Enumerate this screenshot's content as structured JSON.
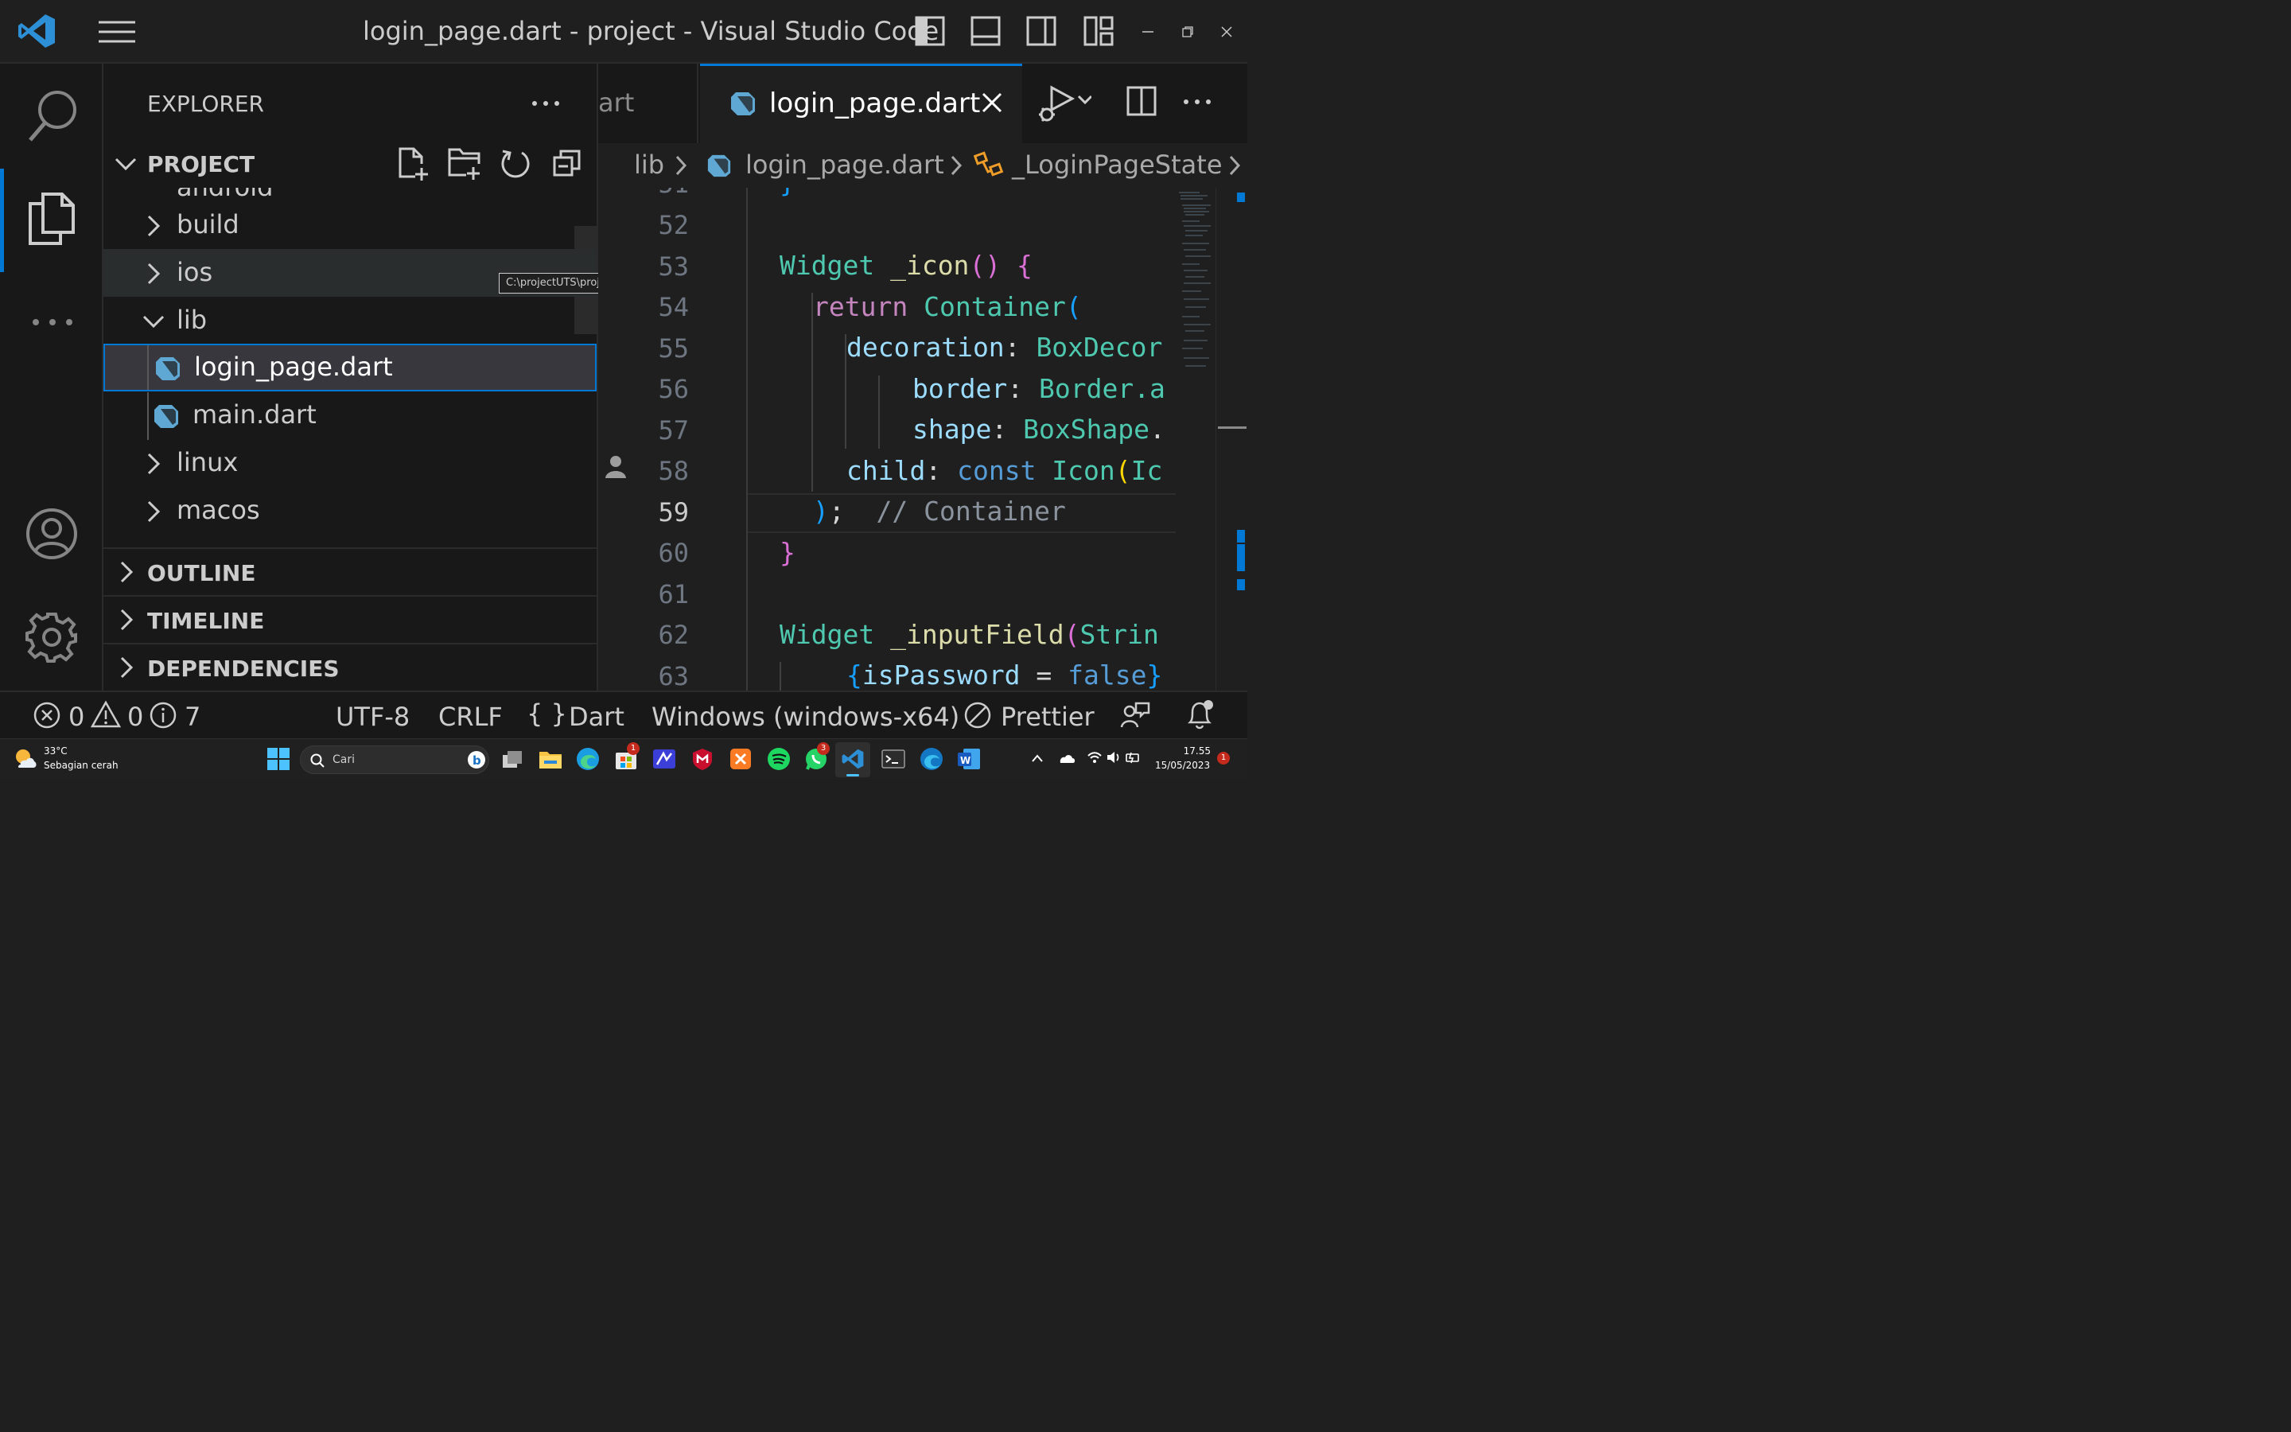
{
  "window": {
    "title": "login_page.dart - project - Visual Studio Code"
  },
  "sidebar": {
    "header": "EXPLORER",
    "project_label": "PROJECT",
    "tree": [
      {
        "label": "build",
        "type": "folder",
        "expanded": false
      },
      {
        "label": "ios",
        "type": "folder",
        "expanded": false
      },
      {
        "label": "lib",
        "type": "folder",
        "expanded": true
      },
      {
        "label": "login_page.dart",
        "type": "file",
        "selected": true
      },
      {
        "label": "main.dart",
        "type": "file"
      },
      {
        "label": "linux",
        "type": "folder",
        "expanded": false
      },
      {
        "label": "macos",
        "type": "folder",
        "expanded": false
      }
    ],
    "tooltip": "C:\\projectUTS\\project\\ios",
    "sections": [
      "OUTLINE",
      "TIMELINE",
      "DEPENDENCIES"
    ]
  },
  "tabs": {
    "inactive_partial": "art",
    "active": "login_page.dart"
  },
  "breadcrumbs": [
    "lib",
    "login_page.dart",
    "_LoginPageState"
  ],
  "editor": {
    "line_numbers": [
      "52",
      "53",
      "54",
      "55",
      "56",
      "57",
      "58",
      "59",
      "60",
      "61",
      "62",
      "63"
    ],
    "current_line": "59",
    "code": {
      "l53_a": "Widget",
      "l53_b": " _icon",
      "l53_c": "()",
      "l53_d": " {",
      "l54_a": "return",
      "l54_b": " Container",
      "l54_c": "(",
      "l55_a": "decoration",
      "l55_b": ": ",
      "l55_c": "BoxDecor",
      "l56_a": "border",
      "l56_b": ": ",
      "l56_c": "Border",
      "l56_d": ".a",
      "l57_a": "shape",
      "l57_b": ": ",
      "l57_c": "BoxShape",
      "l57_d": ".",
      "l58_a": "child",
      "l58_b": ": ",
      "l58_c": "const",
      "l58_d": " Icon",
      "l58_e": "(",
      "l58_f": "Ic",
      "l59_a": ")",
      "l59_b": ";",
      "l59_c": "  // Container",
      "l60_a": "}",
      "l62_a": "Widget",
      "l62_b": " _inputField",
      "l62_c": "(",
      "l62_d": "Strin",
      "l63_a": "{",
      "l63_b": "isPassword",
      "l63_c": " = ",
      "l63_d": "false",
      "l63_e": "}",
      "l51_a": "}"
    }
  },
  "statusbar": {
    "errors": "0",
    "warnings": "0",
    "infos": "7",
    "encoding": "UTF-8",
    "eol": "CRLF",
    "language_braces": "{ }",
    "language": "Dart",
    "platform": "Windows (windows-x64)",
    "formatter": "Prettier"
  },
  "taskbar": {
    "weather_temp": "33°C",
    "weather_desc": "Sebagian cerah",
    "search_placeholder": "Cari",
    "time": "17.55",
    "date": "15/05/2023",
    "notif_count": "1",
    "badge_store": "1",
    "badge_whatsapp": "3"
  },
  "colors": {
    "accent": "#0078d4",
    "background": "#1f1f1f",
    "sidebar": "#181818"
  }
}
